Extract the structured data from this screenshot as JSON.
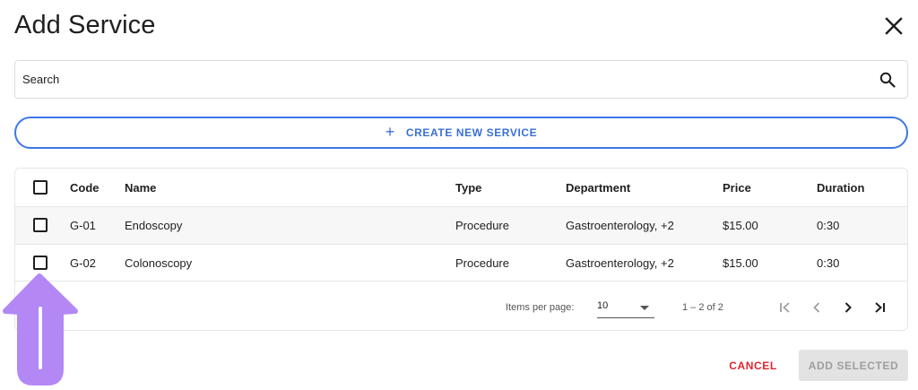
{
  "dialog": {
    "title": "Add Service",
    "close_icon": "close-icon"
  },
  "search": {
    "placeholder": "Search",
    "icon": "search-icon"
  },
  "create_button": {
    "icon": "plus-icon",
    "label": "CREATE NEW SERVICE",
    "color": "#3b78e7"
  },
  "table": {
    "columns": [
      "Code",
      "Name",
      "Type",
      "Department",
      "Price",
      "Duration"
    ],
    "rows": [
      {
        "code": "G-01",
        "name": "Endoscopy",
        "type": "Procedure",
        "department": "Gastroenterology, +2",
        "price": "$15.00",
        "duration": "0:30",
        "selected": false
      },
      {
        "code": "G-02",
        "name": "Colonoscopy",
        "type": "Procedure",
        "department": "Gastroenterology, +2",
        "price": "$15.00",
        "duration": "0:30",
        "selected": false
      }
    ]
  },
  "paginator": {
    "items_per_page_label": "Items per page:",
    "items_per_page_value": "10",
    "range": "1 – 2 of 2",
    "icons": [
      "first-page-icon",
      "previous-page-icon",
      "next-page-icon",
      "last-page-icon"
    ]
  },
  "footer": {
    "cancel_label": "CANCEL",
    "cancel_color": "#e0242f",
    "add_selected_label": "ADD SELECTED"
  },
  "annotation": {
    "arrow_color": "#b388f5",
    "arrow_icon": "up-arrow-icon"
  }
}
